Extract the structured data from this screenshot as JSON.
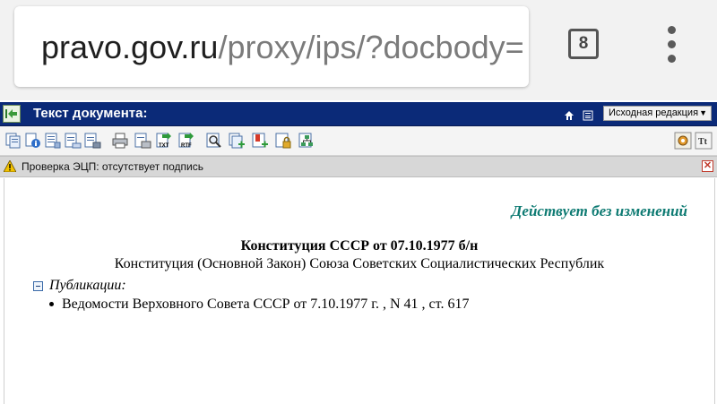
{
  "browser": {
    "url_host": "pravo.gov.ru",
    "url_path": "/proxy/ips/?docbody=",
    "tab_count": "8",
    "icons": {
      "menu": "kebab-menu-icon",
      "tabs": "tab-switcher-icon"
    }
  },
  "titlebar": {
    "title": "Текст документа:",
    "edition_select": "Исходная редакция",
    "icons": [
      "back-icon",
      "home-icon",
      "list-icon"
    ]
  },
  "toolbar": {
    "left_buttons": [
      "copy-icon",
      "info-icon",
      "doc-list-icon",
      "doc-edit-icon",
      "print-icon",
      "print-preview-icon",
      "save-txt-icon",
      "save-rtf-icon",
      "search-icon",
      "add-icon",
      "add-bookmark-icon",
      "lock-icon",
      "tree-icon"
    ],
    "right_buttons": [
      "settings-icon",
      "font-size-icon"
    ],
    "txt_label": "TXT",
    "rtf_label": "RTF",
    "font_label": "Tt"
  },
  "warning": {
    "text": "Проверка ЭЦП: отсутствует подпись",
    "close": "✕"
  },
  "document": {
    "status": "Действует без изменений",
    "title": "Конституция СССР от 07.10.1977 б/н",
    "subtitle": "Конституция (Основной Закон) Союза Советских Социалистических Республик",
    "publications_label": "Публикации:",
    "publications": [
      "Ведомости Верховного Совета СССР от 7.10.1977 г. , N 41 , ст. 617"
    ]
  },
  "colors": {
    "titlebar_bg": "#0b2a78",
    "status_text": "#0d7a72",
    "warning_bg": "#d7d7d7"
  }
}
